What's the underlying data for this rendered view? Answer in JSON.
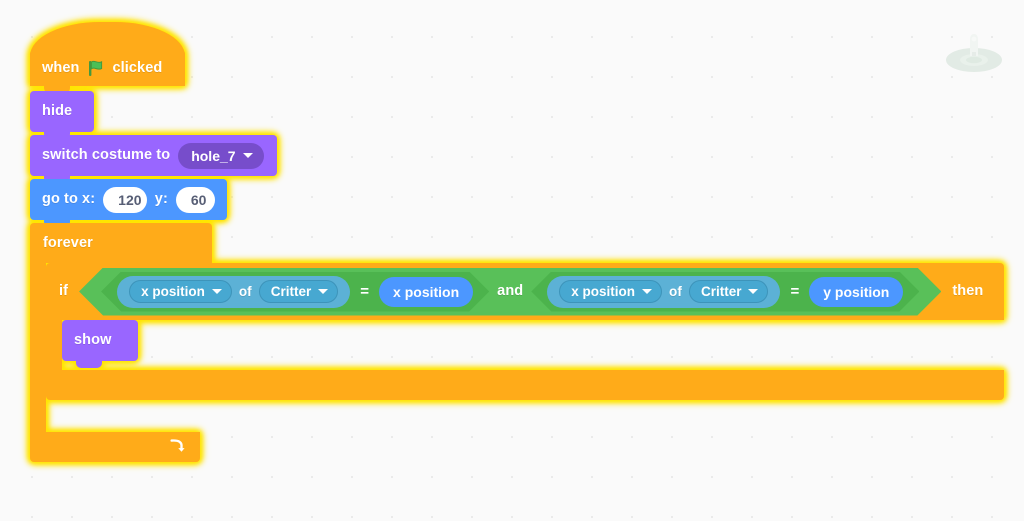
{
  "app": {
    "name": "Scratch Block Editor Workspace",
    "canvas_background": "#fafafa",
    "grid_dot_color": "#eaeaea"
  },
  "colors": {
    "events": "#FFAB19",
    "control": "#FFAB19",
    "looks": "#9966FF",
    "looks_field": "#774DCB",
    "motion": "#4C97FF",
    "sensing": "#5CB1D6",
    "sensing_field": "#47A8D1",
    "operators": "#59C059",
    "operators_inner": "#4CB34C",
    "glow": "#FFE600",
    "input_text": "#575E75"
  },
  "sprite_watermark": {
    "name": "critter-sprite-watermark",
    "visible": true
  },
  "script": {
    "name": "main-script",
    "running": true,
    "blocks": {
      "hat": {
        "prefix": "when",
        "icon": "green-flag-icon",
        "suffix": "clicked"
      },
      "hide": {
        "label": "hide"
      },
      "switch_costume": {
        "label": "switch costume to",
        "costume_value": "hole_7"
      },
      "go_to_xy": {
        "label_x": "go to x:",
        "value_x": "120",
        "label_y": "y:",
        "value_y": "60"
      },
      "forever": {
        "label": "forever",
        "loop_icon": "loop-arrow-icon"
      },
      "if_then": {
        "label_if": "if",
        "label_then": "then",
        "condition": {
          "operator": "and",
          "left": {
            "operator": "=",
            "left": {
              "block": "of",
              "property": "x position",
              "target": "Critter",
              "of_label": "of"
            },
            "right": {
              "block": "reporter",
              "label": "x position"
            }
          },
          "right": {
            "operator": "=",
            "left": {
              "block": "of",
              "property": "x position",
              "target": "Critter",
              "of_label": "of"
            },
            "right": {
              "block": "reporter",
              "label": "y position"
            }
          }
        },
        "body": {
          "show": {
            "label": "show"
          }
        }
      }
    }
  }
}
